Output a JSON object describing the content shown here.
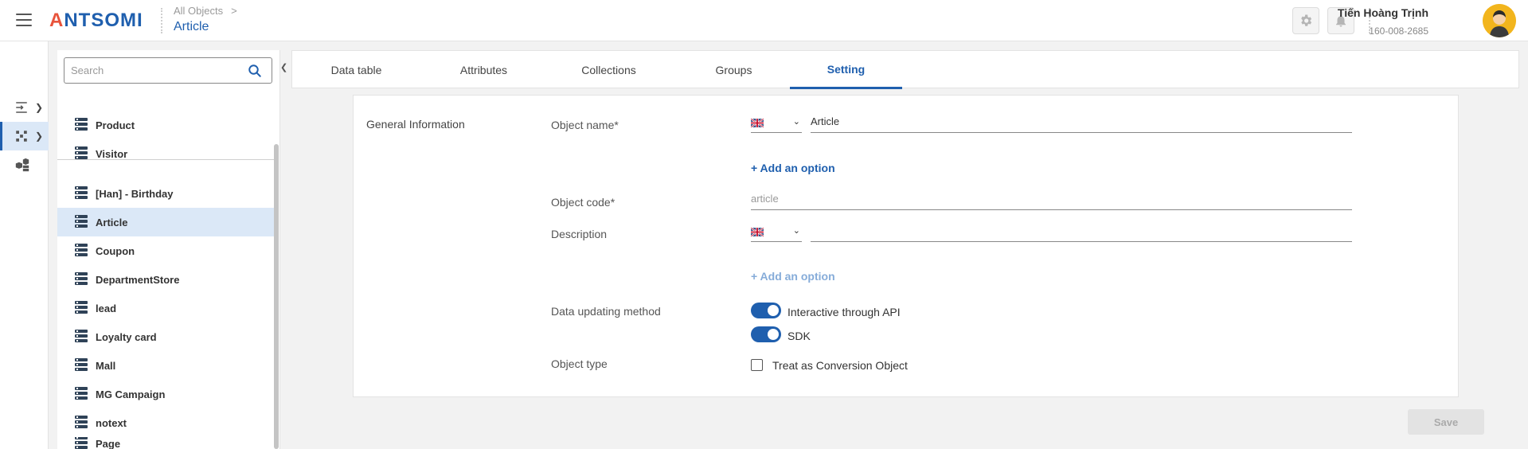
{
  "header": {
    "logo_text_a": "A",
    "logo_text_rest": "NTSOMI",
    "breadcrumb_parent": "All Objects",
    "breadcrumb_chevron": ">",
    "page_title": "Article",
    "user_name": "Tiến Hoàng Trịnh",
    "user_id": "160-008-2685"
  },
  "colors": {
    "accent": "#1f5fae",
    "logo_accent": "#e8533b",
    "selected_bg": "#dbe8f7",
    "toggle_on": "#1f5fae"
  },
  "sidebar": {
    "search_placeholder": "Search",
    "items": [
      {
        "label": "Product",
        "icon": "database-icon"
      },
      {
        "label": "Visitor",
        "icon": "database-icon"
      },
      {
        "label": "[Han] - Birthday",
        "icon": "database-icon"
      },
      {
        "label": "Article",
        "icon": "database-icon",
        "selected": true
      },
      {
        "label": "Coupon",
        "icon": "database-icon"
      },
      {
        "label": "DepartmentStore",
        "icon": "database-icon"
      },
      {
        "label": "lead",
        "icon": "database-icon"
      },
      {
        "label": "Loyalty card",
        "icon": "database-icon"
      },
      {
        "label": "Mall",
        "icon": "database-icon"
      },
      {
        "label": "MG Campaign",
        "icon": "database-icon"
      },
      {
        "label": "notext",
        "icon": "database-icon"
      },
      {
        "label": "Page",
        "icon": "database-icon"
      }
    ]
  },
  "tabs": [
    {
      "label": "Data table"
    },
    {
      "label": "Attributes"
    },
    {
      "label": "Collections"
    },
    {
      "label": "Groups"
    },
    {
      "label": "Setting",
      "active": true
    }
  ],
  "settings": {
    "section_title": "General Information",
    "object_name_label": "Object name*",
    "object_name_value": "Article",
    "add_option_label": "+ Add an option",
    "object_code_label": "Object code*",
    "object_code_value": "article",
    "description_label": "Description",
    "description_value": "",
    "data_updating_label": "Data updating method",
    "method_api_label": "Interactive through API",
    "method_sdk_label": "SDK",
    "object_type_label": "Object type",
    "conversion_label": "Treat as Conversion Object"
  },
  "footer": {
    "save_label": "Save"
  }
}
